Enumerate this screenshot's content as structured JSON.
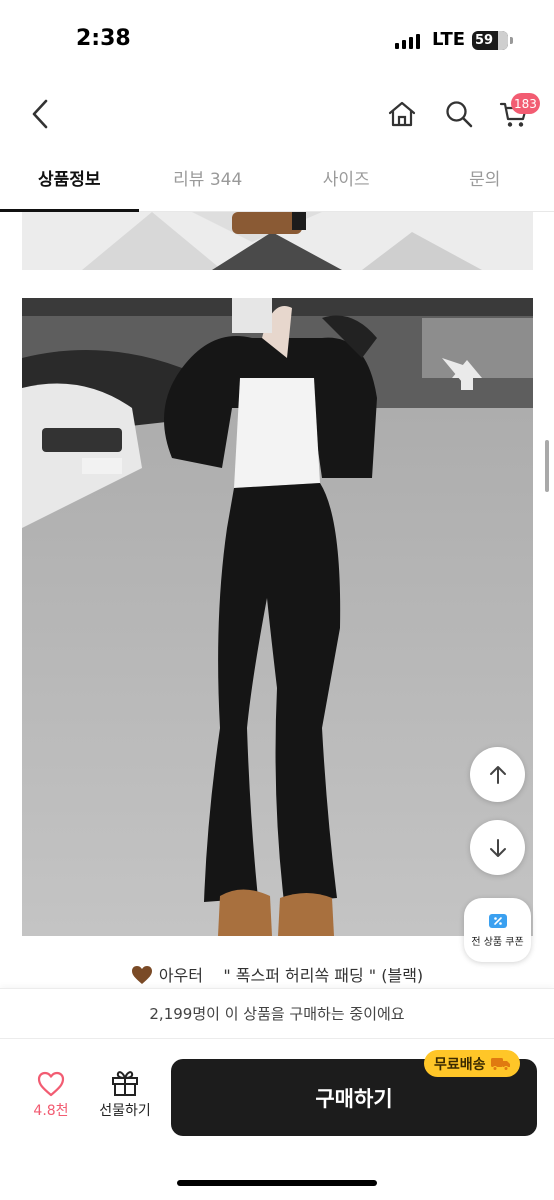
{
  "status_bar": {
    "time": "2:38",
    "network": "LTE",
    "battery": "59",
    "battery_level": 0.59
  },
  "header": {
    "cart_count": "183",
    "icons": [
      "back-chevron-icon",
      "home-icon",
      "search-icon",
      "cart-icon"
    ]
  },
  "tabs": [
    {
      "label": "상품정보",
      "active": true
    },
    {
      "label": "리뷰 344",
      "active": false
    },
    {
      "label": "사이즈",
      "active": false
    },
    {
      "label": "문의",
      "active": false
    }
  ],
  "content": {
    "caption_emoji": "🤎",
    "caption_category": "아우터",
    "caption_name": "\" 폭스퍼 허리쏙 패딩 \" (블랙)"
  },
  "floating": {
    "scroll_up_icon": "arrow-up-icon",
    "scroll_down_icon": "arrow-down-icon",
    "coupon_label": "전 상품 쿠폰"
  },
  "bottom": {
    "buying_now": "2,199명이 이 상품을 구매하는 중이에요",
    "like_count": "4.8천",
    "gift_label": "선물하기",
    "buy_label": "구매하기",
    "free_shipping": "무료배송"
  },
  "colors": {
    "accent_pink": "#f25c72",
    "ship_yellow": "#ffc628",
    "buy_dark": "#1c1c1c"
  }
}
